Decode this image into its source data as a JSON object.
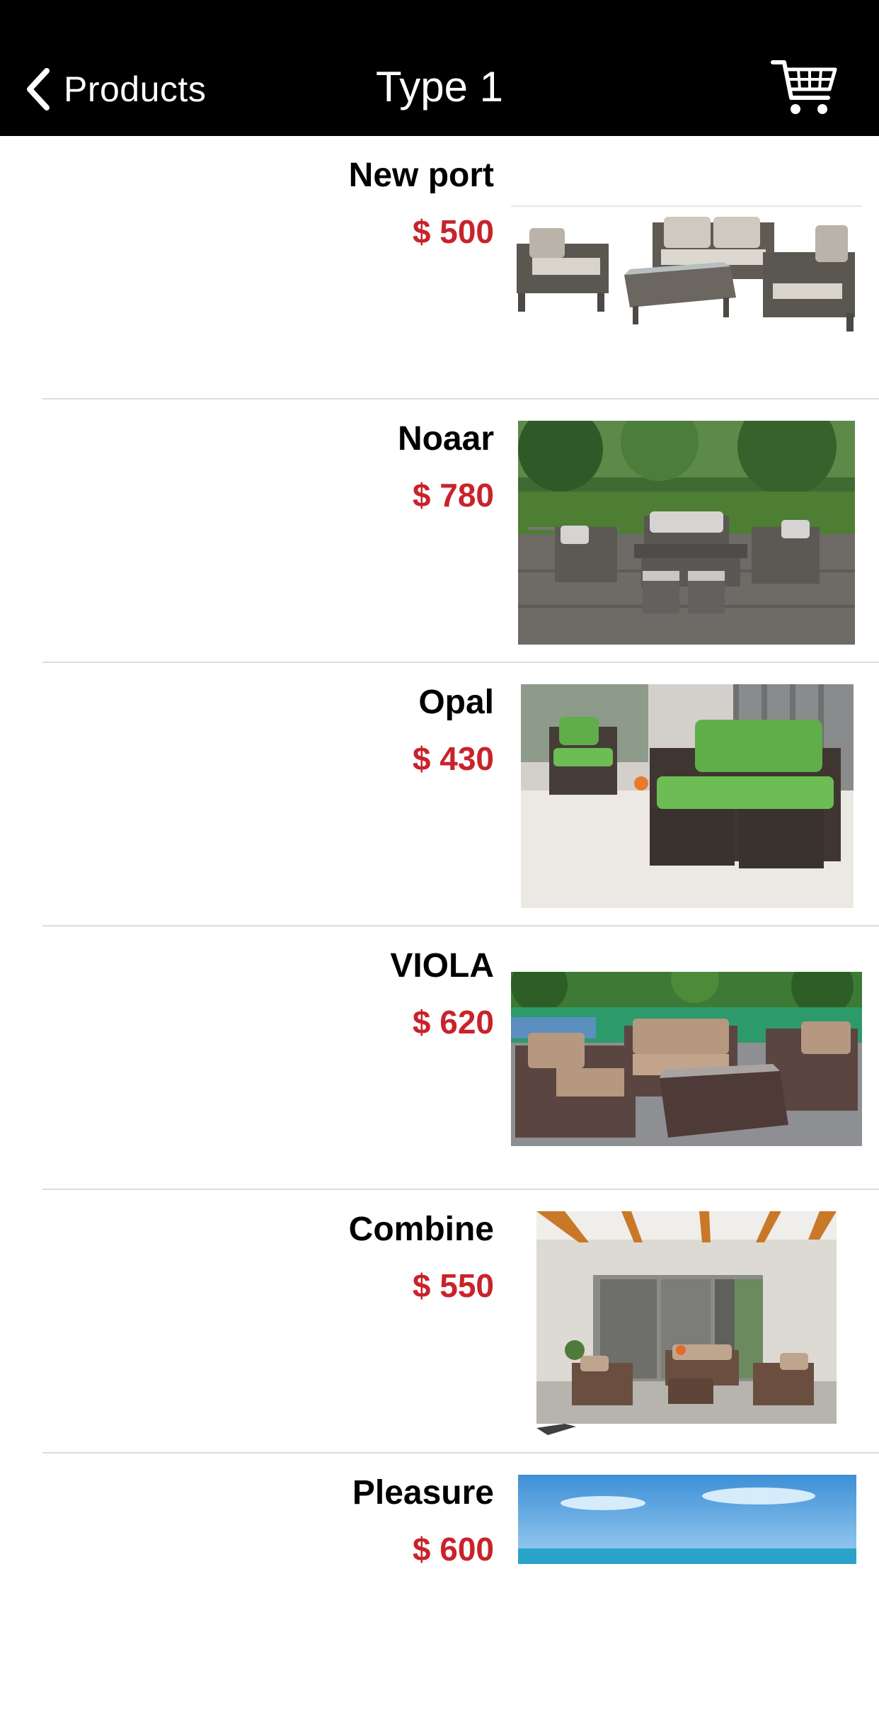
{
  "nav": {
    "back_label": "Products",
    "title": "Type 1",
    "cart_icon": "shopping-cart-icon"
  },
  "products": [
    {
      "name": "New port",
      "price": "$ 500"
    },
    {
      "name": "Noaar",
      "price": "$ 780"
    },
    {
      "name": "Opal",
      "price": "$ 430"
    },
    {
      "name": "VIOLA",
      "price": "$ 620"
    },
    {
      "name": "Combine",
      "price": "$ 550"
    },
    {
      "name": "Pleasure",
      "price": "$ 600"
    }
  ],
  "colors": {
    "navbar_bg": "#000000",
    "price": "#c8232b",
    "separator": "#dcdcdc"
  }
}
